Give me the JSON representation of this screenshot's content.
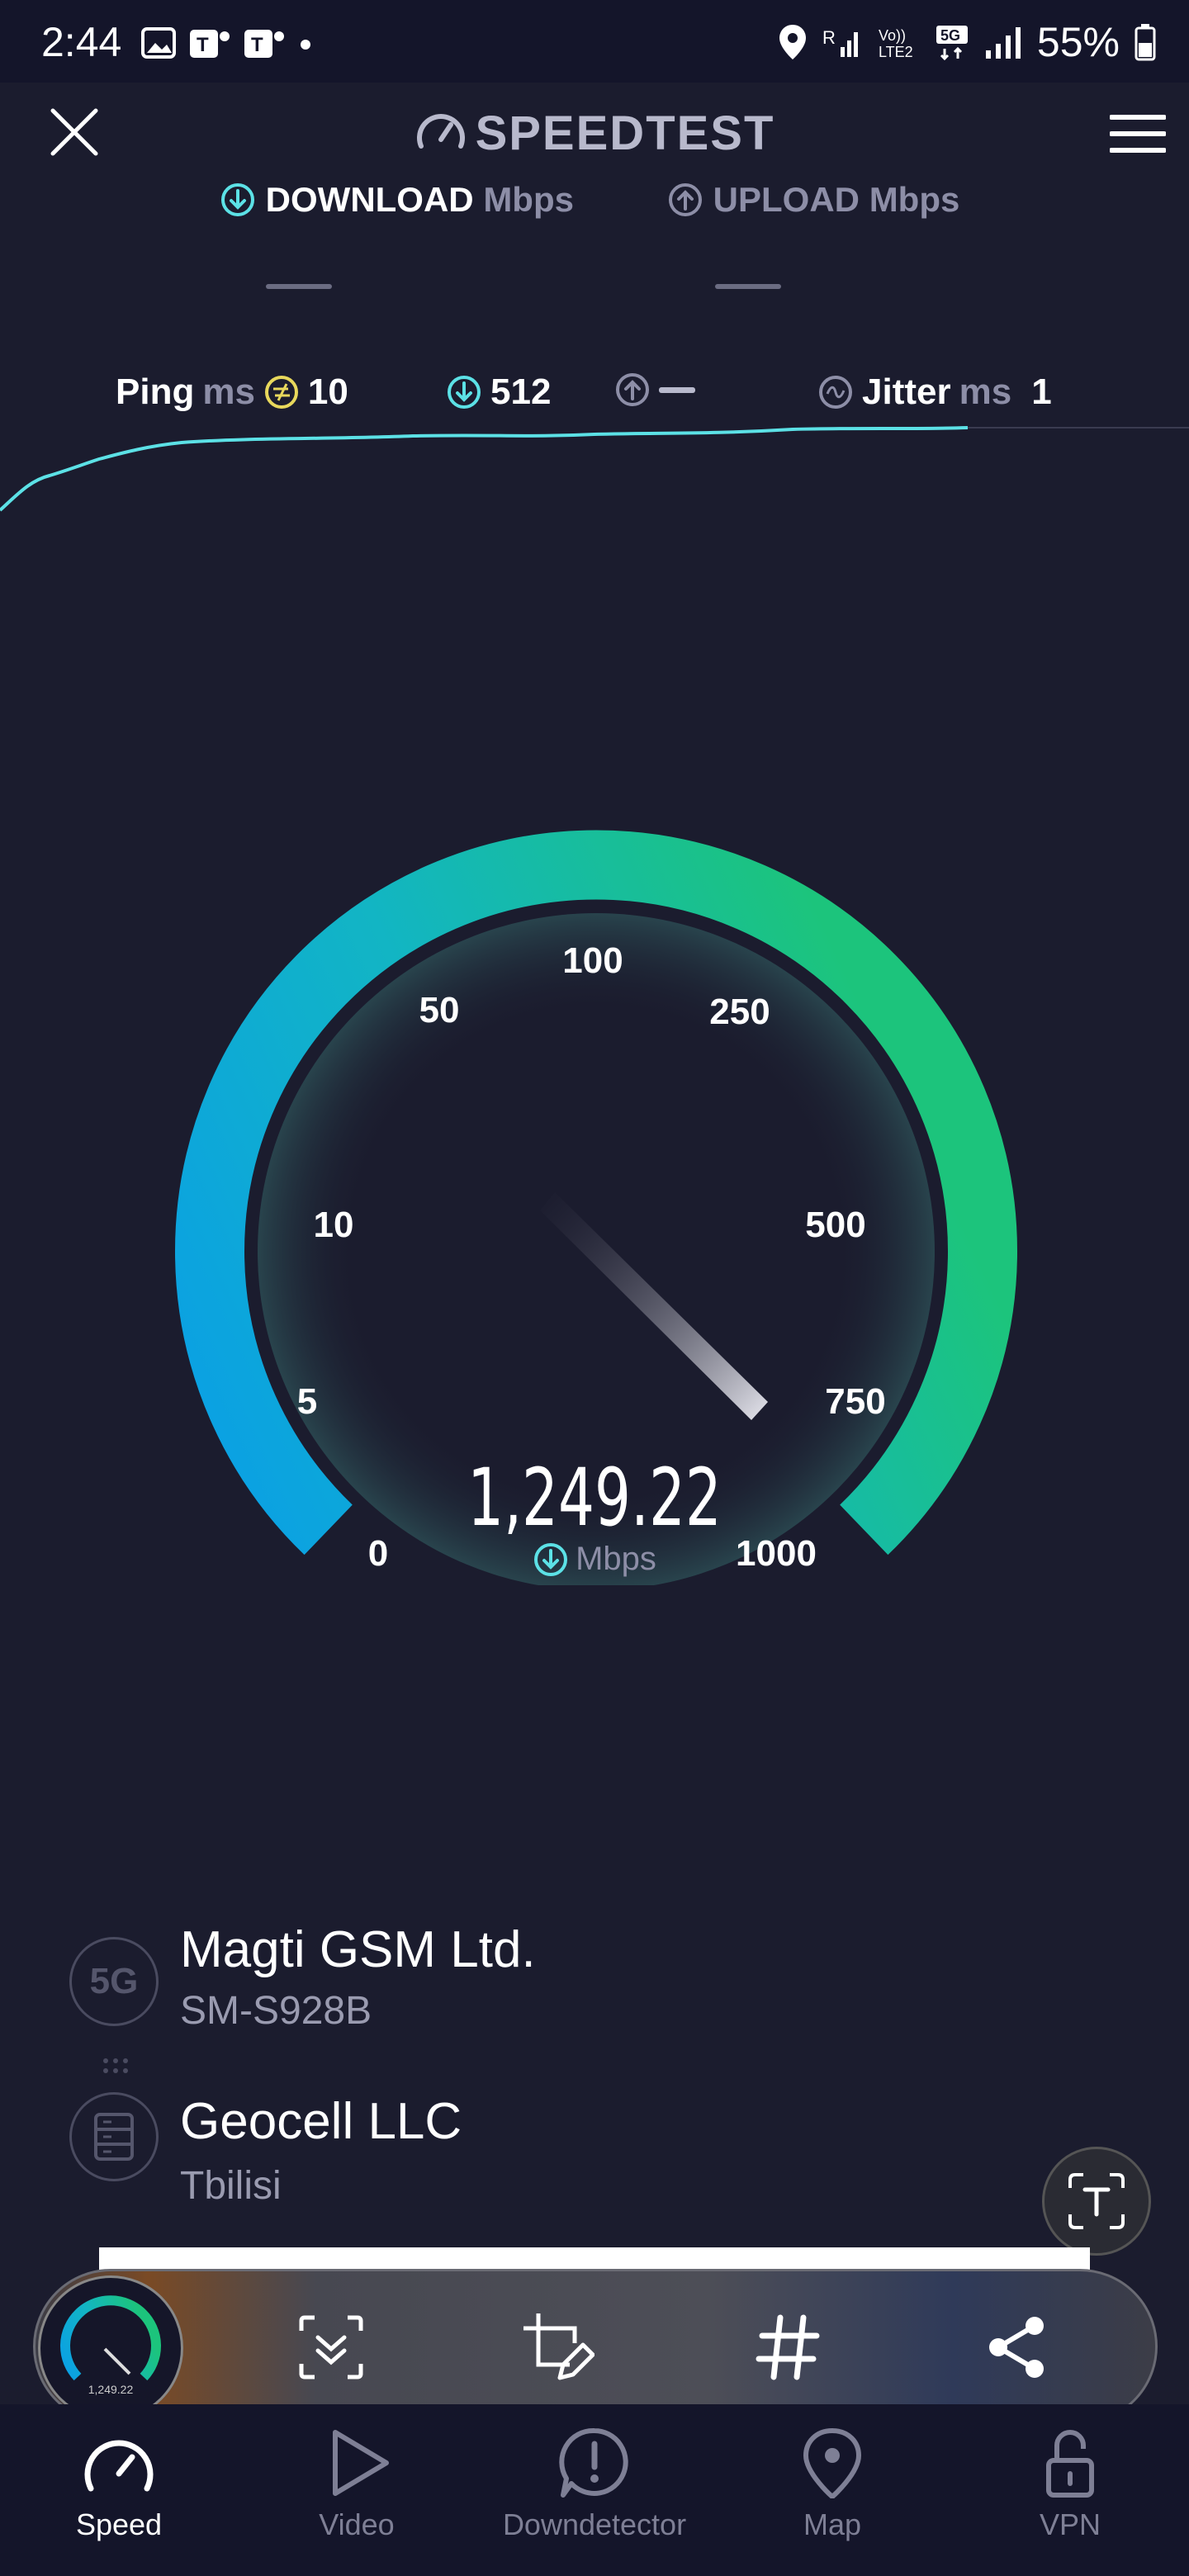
{
  "status_bar": {
    "time": "2:44",
    "battery": "55%"
  },
  "header": {
    "title": "SPEEDTEST",
    "close_icon": "close-icon",
    "menu_icon": "hamburger-menu-icon"
  },
  "tabs": {
    "download": {
      "label": "DOWNLOAD",
      "unit": "Mbps"
    },
    "upload": {
      "label": "UPLOAD",
      "unit": "Mbps"
    }
  },
  "metrics": {
    "ping": {
      "label": "Ping",
      "unit": "ms",
      "value": "10"
    },
    "download": {
      "value": "512"
    },
    "jitter": {
      "label": "Jitter",
      "unit": "ms",
      "value": "1"
    }
  },
  "gauge": {
    "ticks": [
      "0",
      "5",
      "10",
      "50",
      "100",
      "250",
      "500",
      "750",
      "1000"
    ],
    "value": "1,249.22",
    "unit": "Mbps",
    "colors": {
      "start": "#0a9fe6",
      "end": "#1cc47c",
      "accent": "#5ce1e6"
    }
  },
  "isp": {
    "badge": "5G",
    "name": "Magti GSM Ltd.",
    "device": "SM-S928B"
  },
  "server": {
    "name": "Geocell LLC",
    "location": "Tbilisi"
  },
  "toolbar": {
    "thumb_value": "1,249.22",
    "icons": [
      "scroll-capture-icon",
      "edit-crop-icon",
      "hashtag-icon",
      "share-icon"
    ]
  },
  "nav": [
    {
      "label": "Speed",
      "icon": "speedometer-icon",
      "active": true
    },
    {
      "label": "Video",
      "icon": "play-icon"
    },
    {
      "label": "Downdetector",
      "icon": "alert-icon"
    },
    {
      "label": "Map",
      "icon": "map-pin-icon"
    },
    {
      "label": "VPN",
      "icon": "lock-icon"
    }
  ]
}
